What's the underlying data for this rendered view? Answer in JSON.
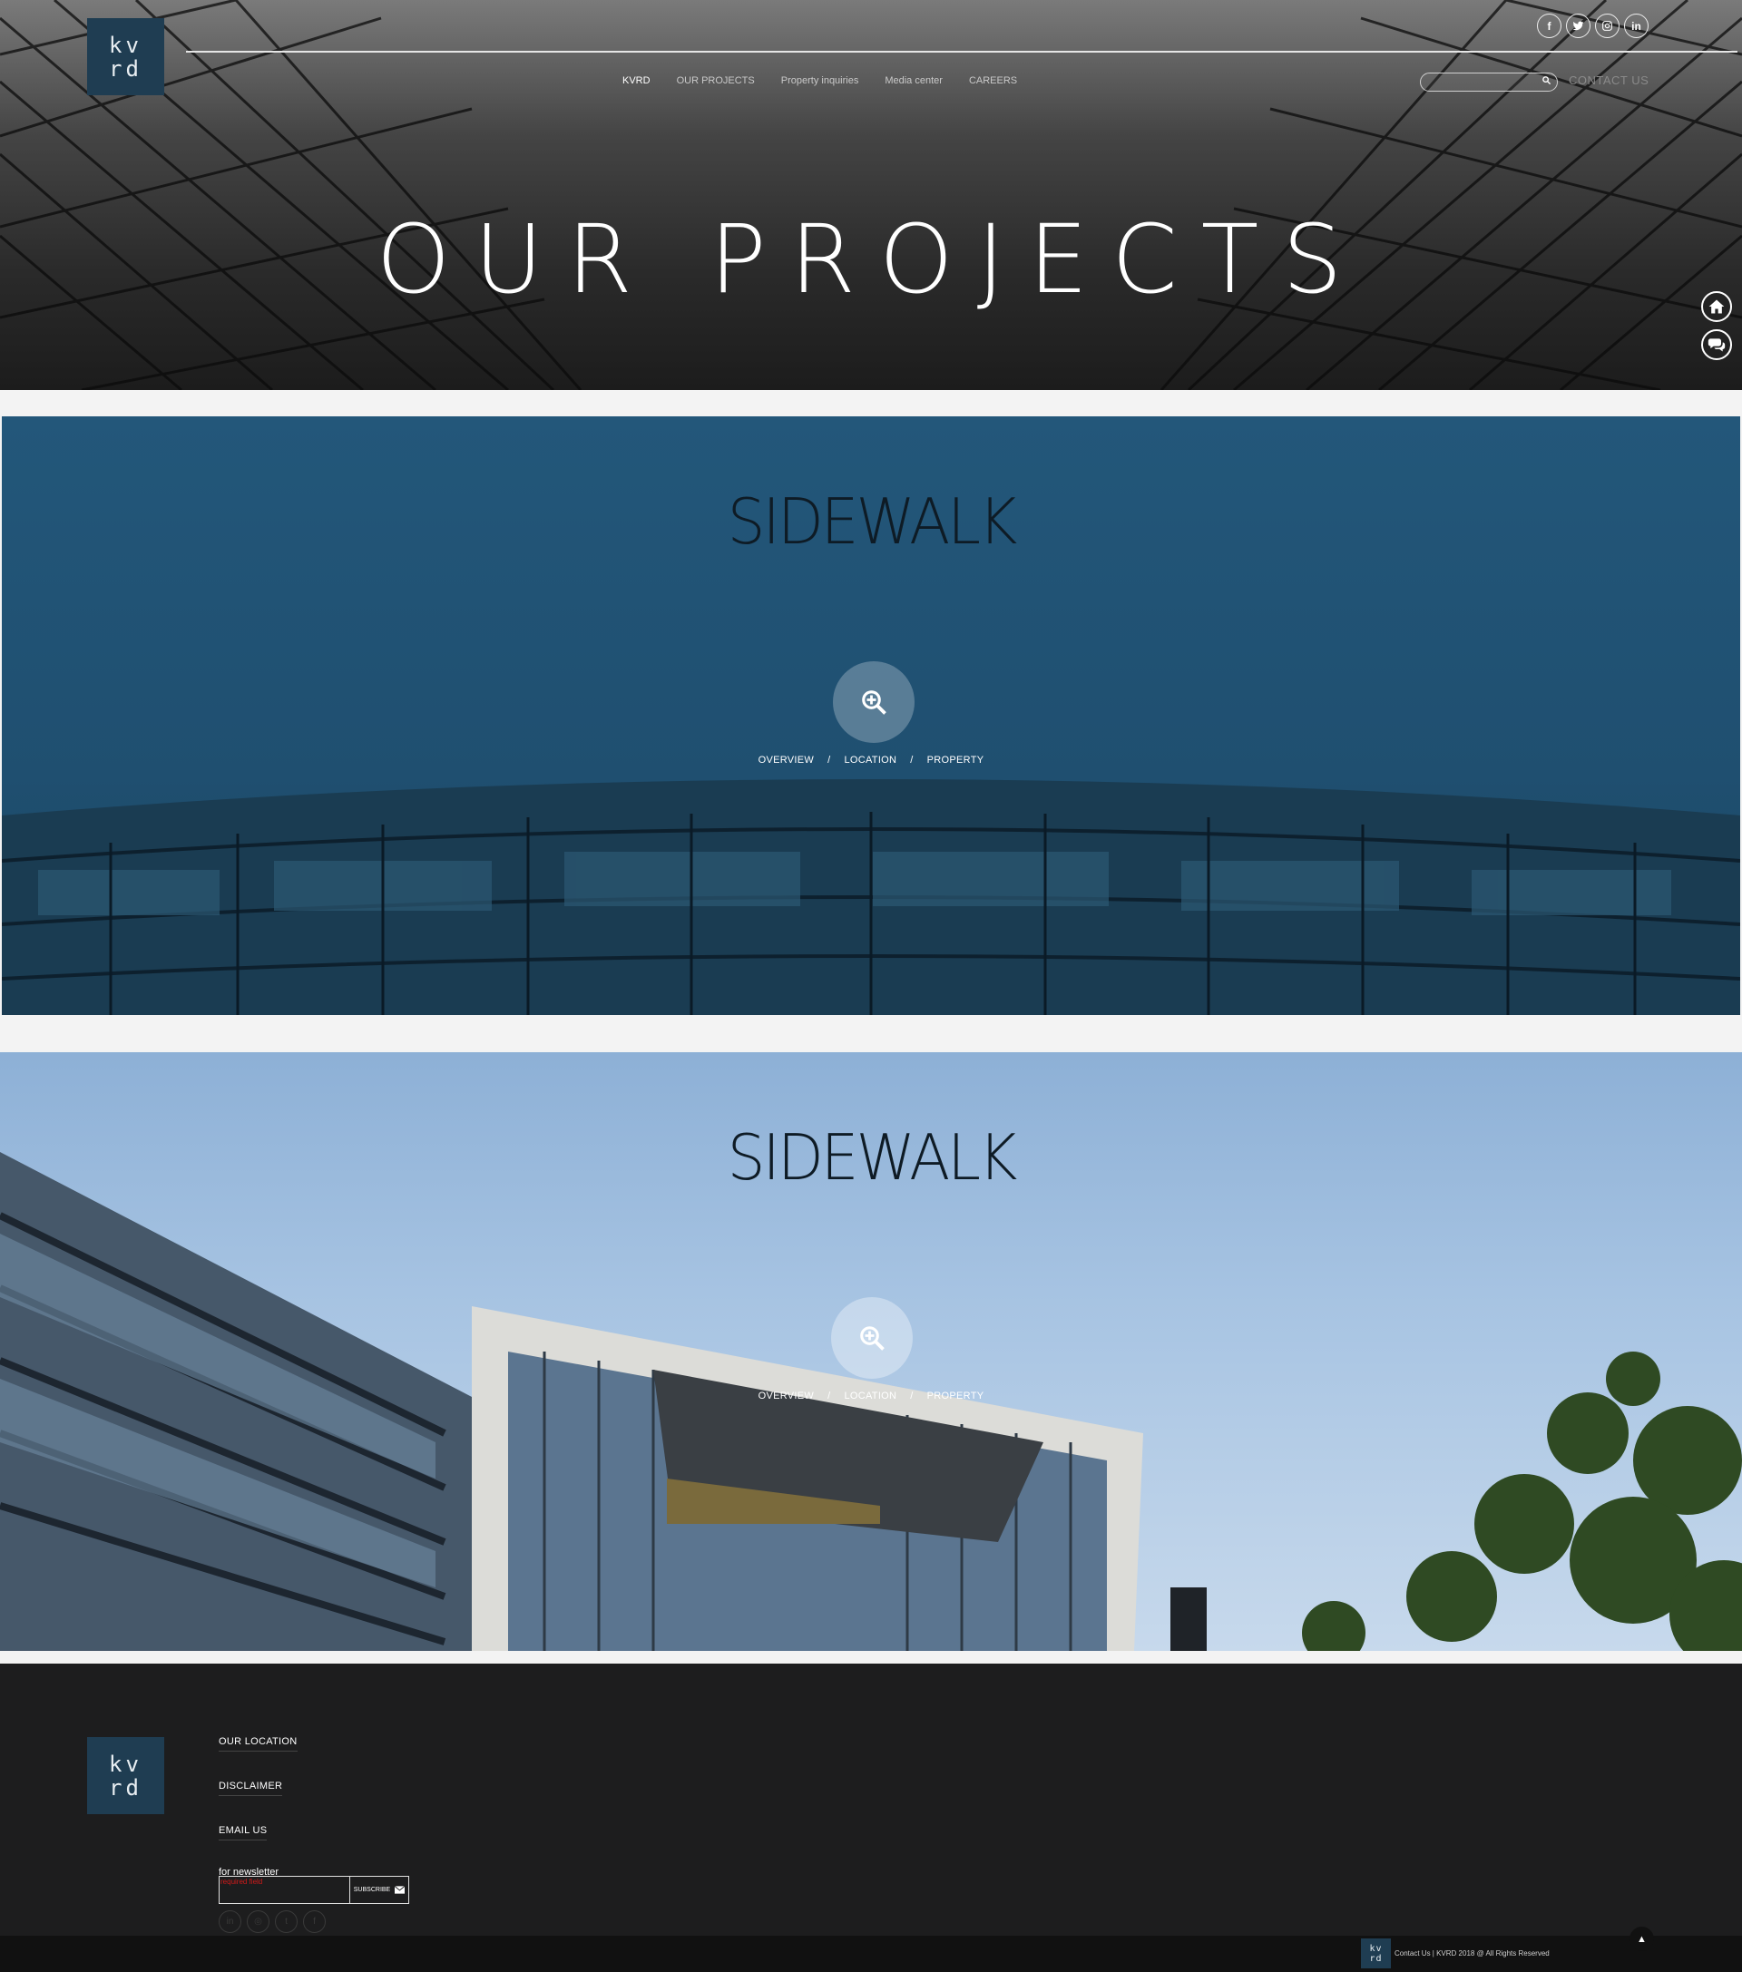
{
  "header": {
    "logo_line1": "kv",
    "logo_line2": "rd",
    "nav": [
      "KVRD",
      "OUR PROJECTS",
      "Property inquiries",
      "Media center",
      "CAREERS"
    ],
    "social_icons": [
      "facebook-icon",
      "twitter-icon",
      "instagram-icon",
      "linkedin-icon"
    ],
    "search_placeholder": "",
    "contact_label": "CONTACT US"
  },
  "hero": {
    "title": "OUR PROJECTS"
  },
  "side_buttons": [
    "home-icon",
    "chat-icon"
  ],
  "projects": [
    {
      "title": "SIDEWALK",
      "links": [
        "OVERVIEW",
        "LOCATION",
        "PROPERTY"
      ],
      "separator": "/"
    },
    {
      "title": "SIDEWALK",
      "links": [
        "OVERVIEW",
        "LOCATION",
        "PROPERTY"
      ],
      "separator": "/"
    }
  ],
  "footer": {
    "logo_line1": "kv",
    "logo_line2": "rd",
    "links": [
      "OUR LOCATION",
      "DISCLAIMER",
      "EMAIL US"
    ],
    "newsletter_label": "for newsletter",
    "newsletter_error": "required field",
    "subscribe_label": "SUBSCRIBE",
    "social_icons": [
      "linkedin-icon",
      "instagram-icon",
      "twitter-icon",
      "facebook-icon"
    ],
    "copyright": "Contact Us | KVRD 2018 @ All Rights Reserved"
  },
  "colors": {
    "brand": "#1f3d52",
    "footer_bg": "#1d1d1e",
    "project1_bg": "#23577a",
    "project2_sky": "#a6c3e2"
  }
}
